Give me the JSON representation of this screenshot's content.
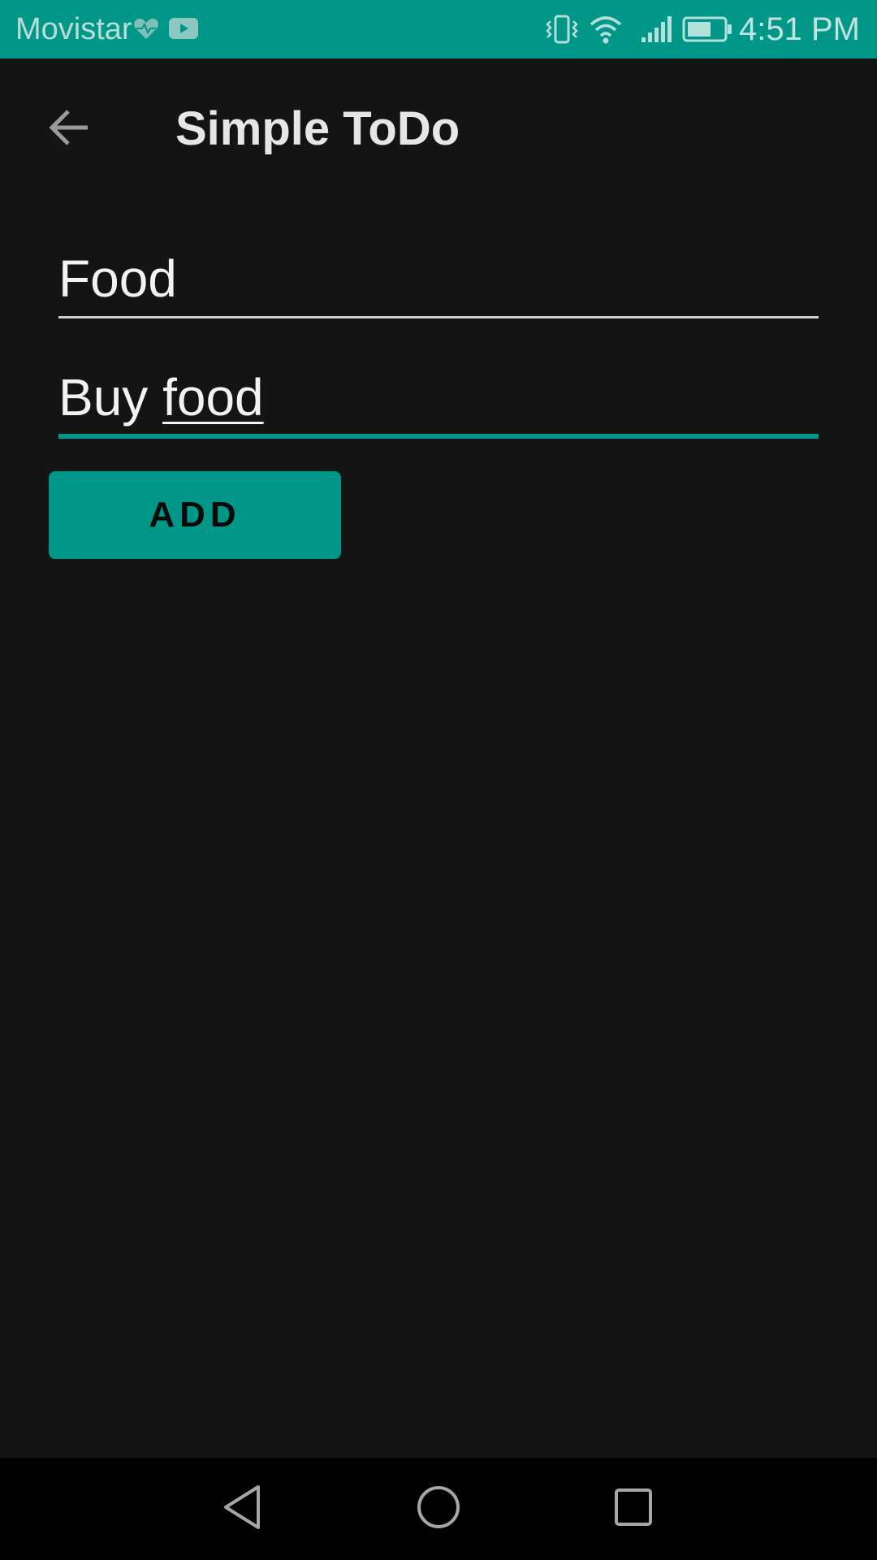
{
  "status_bar": {
    "carrier": "Movistar",
    "time": "4:51 PM",
    "icons": [
      "heart-icon",
      "youtube-icon",
      "vibrate-icon",
      "wifi-icon",
      "signal-icon",
      "battery-icon"
    ],
    "background": "#009688"
  },
  "app_bar": {
    "title": "Simple ToDo",
    "back_icon": "arrow-back-icon"
  },
  "form": {
    "title_value": "Food",
    "description_value": "Buy food",
    "description_prefix": "Buy ",
    "description_composing": "food",
    "add_label": "ADD"
  },
  "nav_bar": {
    "icons": [
      "nav-back-icon",
      "nav-home-icon",
      "nav-recents-icon"
    ]
  },
  "colors": {
    "accent": "#009688",
    "background": "#141414",
    "text": "#f2f2f2"
  }
}
